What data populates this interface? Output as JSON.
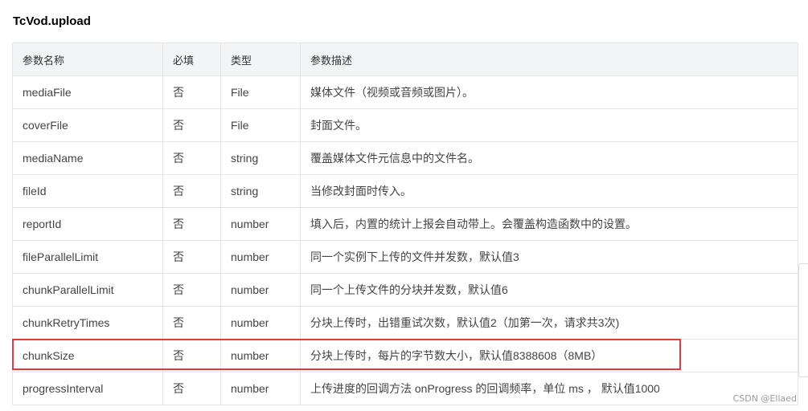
{
  "title": "TcVod.upload",
  "table": {
    "headers": [
      "参数名称",
      "必填",
      "类型",
      "参数描述"
    ],
    "rows": [
      {
        "name": "mediaFile",
        "required": "否",
        "type": "File",
        "description": "媒体文件（视频或音频或图片）。"
      },
      {
        "name": "coverFile",
        "required": "否",
        "type": "File",
        "description": "封面文件。"
      },
      {
        "name": "mediaName",
        "required": "否",
        "type": "string",
        "description": "覆盖媒体文件元信息中的文件名。"
      },
      {
        "name": "fileId",
        "required": "否",
        "type": "string",
        "description": "当修改封面时传入。"
      },
      {
        "name": "reportId",
        "required": "否",
        "type": "number",
        "description": "填入后，内置的统计上报会自动带上。会覆盖构造函数中的设置。"
      },
      {
        "name": "fileParallelLimit",
        "required": "否",
        "type": "number",
        "description": "同一个实例下上传的文件并发数，默认值3"
      },
      {
        "name": "chunkParallelLimit",
        "required": "否",
        "type": "number",
        "description": "同一个上传文件的分块并发数，默认值6"
      },
      {
        "name": "chunkRetryTimes",
        "required": "否",
        "type": "number",
        "description": "分块上传时，出错重试次数，默认值2（加第一次，请求共3次)"
      },
      {
        "name": "chunkSize",
        "required": "否",
        "type": "number",
        "description": "分块上传时，每片的字节数大小，默认值8388608（8MB）"
      },
      {
        "name": "progressInterval",
        "required": "否",
        "type": "number",
        "description": "上传进度的回调方法 onProgress 的回调频率，单位 ms ， 默认值1000"
      }
    ]
  },
  "highlight": {
    "row_name": "chunkSize",
    "color": "#e03a3e"
  },
  "watermark": "CSDN @Ellaed"
}
